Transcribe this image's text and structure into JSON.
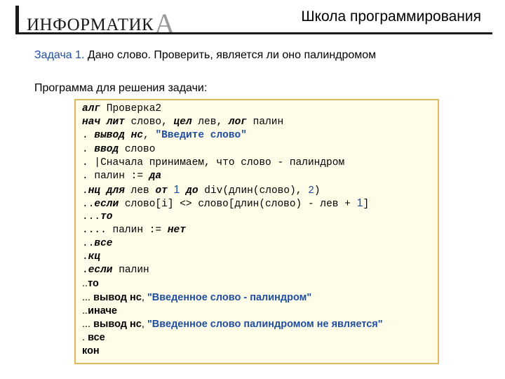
{
  "header": {
    "logo_text": "ИНФОРМАТИК",
    "logo_letter": "А",
    "school_title": "Школа программирования"
  },
  "task": {
    "label": "Задача 1.",
    "text": " Дано слово. Проверить, является ли оно палиндромом"
  },
  "program_heading": "Программа для решения задачи:",
  "code": {
    "l1": {
      "a": "алг",
      "b": " Проверка2"
    },
    "l2": {
      "a": "нач",
      "b": " ",
      "c": "лит",
      "d": " слово, ",
      "e": "цел",
      "f": " лев, ",
      "g": "лог",
      "h": " палин"
    },
    "l3": {
      "a": ". ",
      "b": "вывод нс",
      "c": ", ",
      "d": "\"Введите слово\""
    },
    "l4": {
      "a": ". ",
      "b": "ввод",
      "c": " слово"
    },
    "l5": {
      "a": ". |Сначала принимаем, что слово - палиндром"
    },
    "l6": {
      "a": ". палин := ",
      "b": "да"
    },
    "l7": {
      "a": ".",
      "b": "нц для",
      "c": " лев ",
      "d": "от",
      "e": " ",
      "f": "1",
      "g": " ",
      "h": "до",
      "i": " div(длин(слово), ",
      "j": "2",
      "k": ")"
    },
    "l8": {
      "a": "..",
      "b": "если",
      "c": " слово[i] <> слово[длин(слово) - лев + ",
      "d": "1",
      "e": "]"
    },
    "l9": {
      "a": "...",
      "b": "то"
    },
    "l10": {
      "a": ".... палин := ",
      "b": "нет"
    },
    "l11": {
      "a": "..",
      "b": "все"
    },
    "l12": {
      "a": ".",
      "b": "кц"
    },
    "l13": {
      "a": ".",
      "b": "если",
      "c": " палин"
    },
    "l14": {
      "a": "..",
      "b": "то"
    },
    "l15": {
      "a": "... ",
      "b": "вывод нс",
      "c": ", ",
      "d": "\"Введенное слово - палиндром\""
    },
    "l16": {
      "a": "..",
      "b": "иначе"
    },
    "l17": {
      "a": "... ",
      "b": "вывод нс",
      "c": ", ",
      "d": "\"Введенное слово палиндромом не является\""
    },
    "l18": {
      "a": ". ",
      "b": "все"
    },
    "l19": {
      "a": "кон"
    }
  },
  "colors": {
    "accent": "#1f4ea0",
    "code_background": "#fffde8",
    "code_border": "#e0b860"
  }
}
